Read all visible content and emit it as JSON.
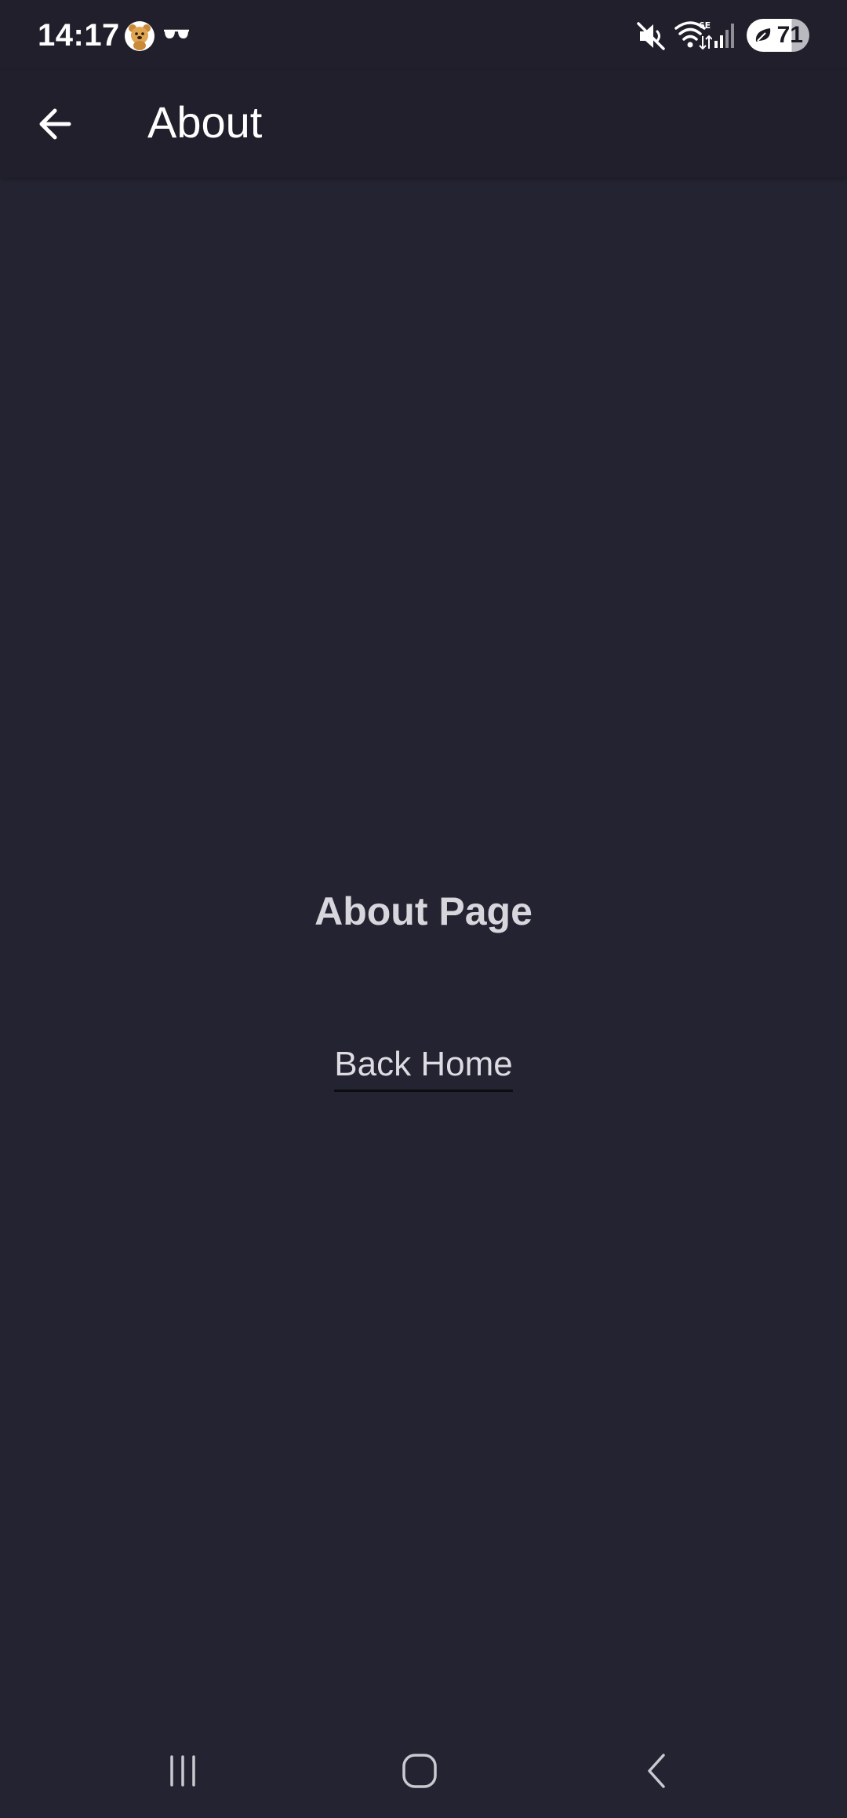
{
  "status_bar": {
    "time": "14:17",
    "left_icons": [
      "bear-app-icon",
      "glasses-icon"
    ],
    "right_icons": [
      "mute-icon",
      "wifi-6e-icon",
      "signal-icon",
      "battery-icon"
    ],
    "battery_level": "71"
  },
  "app_bar": {
    "back_icon": "arrow-left-icon",
    "title": "About"
  },
  "content": {
    "heading": "About Page",
    "back_home_link": "Back Home"
  },
  "nav_bar": {
    "buttons": [
      "recents-icon",
      "home-icon",
      "back-icon"
    ]
  },
  "colors": {
    "background": "#242331",
    "app_bar": "#201f2b",
    "text_primary": "#ffffff",
    "text_secondary": "#d6d6dc"
  }
}
